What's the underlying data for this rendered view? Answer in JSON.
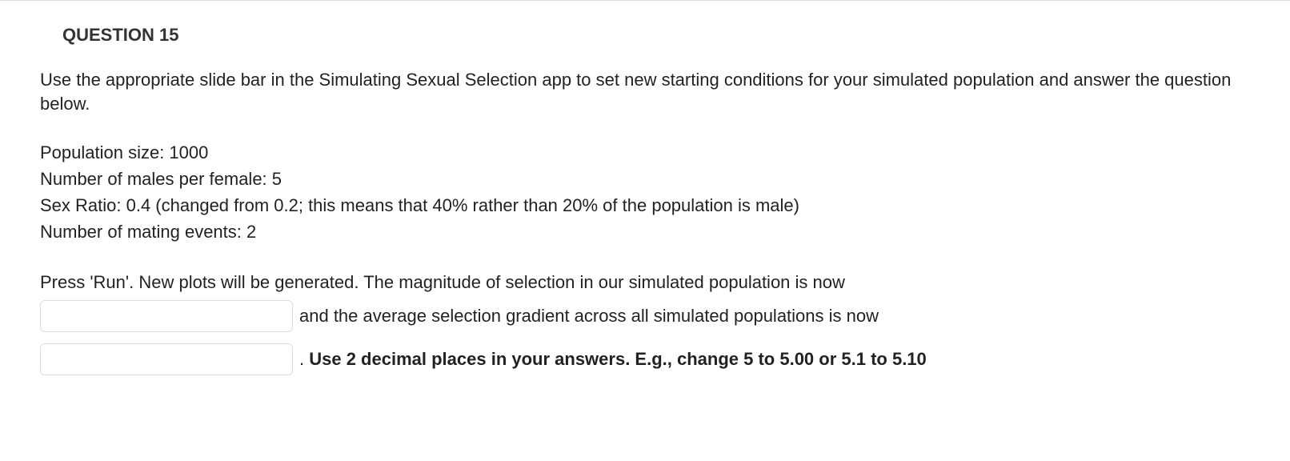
{
  "question": {
    "title": "QUESTION 15",
    "intro": "Use the appropriate slide bar in the Simulating Sexual Selection app to set new starting conditions for your simulated population and answer the question below.",
    "params": {
      "line1": "Population size: 1000",
      "line2": "Number of males per female: 5",
      "line3": "Sex Ratio: 0.4  (changed from 0.2; this means that 40% rather than 20% of the population is male)",
      "line4": "Number of mating events: 2"
    },
    "prompt_line": "Press 'Run'. New plots will be generated. The magnitude of selection in our simulated population is now",
    "after_input1": " and the average selection gradient across all simulated populations is now",
    "after_input2_prefix": ". ",
    "bold_note": "Use 2 decimal places in your answers. E.g., change 5 to 5.00 or 5.1 to 5.10",
    "input1_value": "",
    "input2_value": ""
  }
}
